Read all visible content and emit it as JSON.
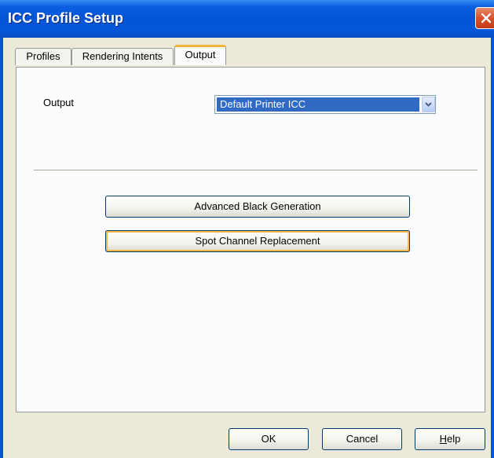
{
  "window": {
    "title": "ICC Profile Setup"
  },
  "tabs": [
    {
      "label": "Profiles",
      "active": false
    },
    {
      "label": "Rendering Intents",
      "active": false
    },
    {
      "label": "Output",
      "active": true
    }
  ],
  "output_panel": {
    "output_label": "Output",
    "output_select": {
      "selected": "Default Printer ICC"
    },
    "advanced_black_label": "Advanced Black Generation",
    "spot_channel_label": "Spot Channel Replacement"
  },
  "footer": {
    "ok_label": "OK",
    "cancel_label": "Cancel",
    "help_label_mnemonic": "H",
    "help_label_rest": "elp"
  },
  "colors": {
    "titlebar": "#0554d6",
    "selection": "#316ac5",
    "focus_highlight": "#f8b743"
  },
  "icons": [
    "close-icon",
    "chevron-down-icon"
  ]
}
